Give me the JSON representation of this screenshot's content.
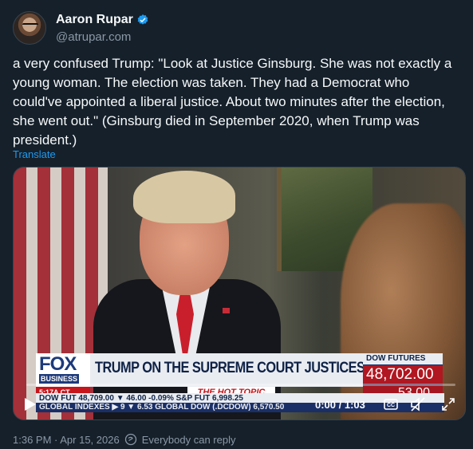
{
  "author": {
    "display_name": "Aaron Rupar",
    "handle": "@atrupar.com",
    "verified": true,
    "avatar_icon": "avatar-image",
    "verified_icon": "verified-badge-icon"
  },
  "tweet": {
    "text": "a very confused Trump: \"Look at Justice Ginsburg. She was not exactly a young woman. The election was taken. They had a Democrat who could've appointed a liberal justice. About two minutes after the election, she went out.\" (Ginsburg died in September 2020, when Trump was president.)",
    "translate_label": "Translate"
  },
  "video": {
    "broadcast": {
      "network_logo": "FOX",
      "network_sub": "BUSINESS",
      "headline": "TRUMP ON THE SUPREME COURT JUSTICES",
      "time": "5:17A CT",
      "hot_topic": "THE HOT TOPIC",
      "dow_label": "DOW FUTURES",
      "dow_value": "48,702.00",
      "dow_change": "53.00",
      "ticker_line1": "DOW FUT 48,709.00 ▼ 46.00  -0.09%  S&P FUT  6,998.25",
      "ticker_line2": "GLOBAL INDEXES ▶ 9  ▼ 6.53  GLOBAL DOW (.DCDOW)  6,570.50"
    },
    "progress": 0,
    "timecode": "0:00 / 1:03",
    "controls": {
      "play_icon": "play-icon",
      "cc_icon": "closed-captions-icon",
      "mute_icon": "muted-speaker-icon",
      "fullscreen_icon": "fullscreen-icon"
    }
  },
  "footer": {
    "timestamp": "1:36 PM · Apr 15, 2026",
    "reply_setting": "Everybody can reply",
    "reply_icon": "reply-setting-icon"
  },
  "colors": {
    "background": "#15202b",
    "accent": "#1d9bf0",
    "secondary_text": "#8b98a5"
  }
}
